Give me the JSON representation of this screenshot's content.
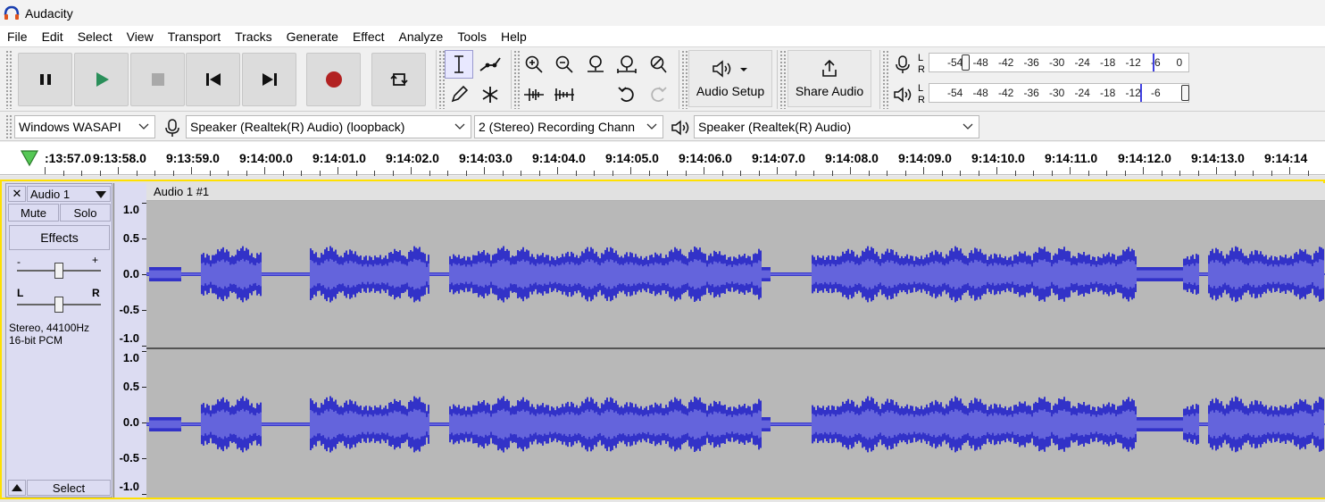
{
  "app": {
    "title": "Audacity"
  },
  "menu": [
    "File",
    "Edit",
    "Select",
    "View",
    "Transport",
    "Tracks",
    "Generate",
    "Effect",
    "Analyze",
    "Tools",
    "Help"
  ],
  "toolbar": {
    "audio_setup_label": "Audio Setup",
    "share_audio_label": "Share Audio",
    "meter_ticks": [
      "-54",
      "-48",
      "-42",
      "-36",
      "-30",
      "-24",
      "-18",
      "-12",
      "-6",
      "0"
    ],
    "meter_ticks_playback": [
      "-54",
      "-48",
      "-42",
      "-36",
      "-30",
      "-24",
      "-18",
      "-12",
      "-6"
    ],
    "lr_left": "L",
    "lr_right": "R"
  },
  "devices": {
    "host": "Windows WASAPI",
    "recording_device": "Speaker (Realtek(R) Audio) (loopback)",
    "channels": "2 (Stereo) Recording Chann",
    "playback_device": "Speaker (Realtek(R) Audio)"
  },
  "ruler": {
    "labels": [
      ":13:57.0",
      "9:13:58.0",
      "9:13:59.0",
      "9:14:00.0",
      "9:14:01.0",
      "9:14:02.0",
      "9:14:03.0",
      "9:14:04.0",
      "9:14:05.0",
      "9:14:06.0",
      "9:14:07.0",
      "9:14:08.0",
      "9:14:09.0",
      "9:14:10.0",
      "9:14:11.0",
      "9:14:12.0",
      "9:14:13.0",
      "9:14:14"
    ]
  },
  "track": {
    "name": "Audio 1",
    "clip_name": "Audio 1 #1",
    "mute_label": "Mute",
    "solo_label": "Solo",
    "effects_label": "Effects",
    "gain_minus": "-",
    "gain_plus": "+",
    "pan_left": "L",
    "pan_right": "R",
    "info_line1": "Stereo, 44100Hz",
    "info_line2": "16-bit PCM",
    "select_label": "Select",
    "close_label": "✕",
    "vscale": [
      "1.0",
      "0.5",
      "0.0",
      "-0.5",
      "-1.0"
    ]
  },
  "colors": {
    "wave": "#3232c8",
    "wave_rms": "#6464dc",
    "track_bg": "#b8b8b8",
    "record": "#b22222",
    "play": "#2a8f5a"
  }
}
